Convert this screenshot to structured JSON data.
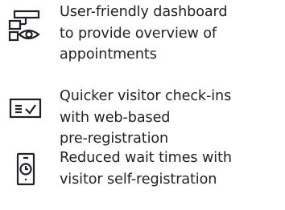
{
  "features": [
    {
      "icon": "dashboard-eye-icon",
      "text": "User-friendly dashboard\nto provide overview of\nappointments"
    },
    {
      "icon": "form-check-icon",
      "text": "Quicker visitor check-ins\nwith web-based\npre-registration"
    },
    {
      "icon": "mobile-clock-icon",
      "text": "Reduced wait times with\nvisitor self-registration"
    }
  ],
  "colors": {
    "icon": "#1f2124",
    "text": "#1f2124",
    "background": "#ffffff"
  }
}
